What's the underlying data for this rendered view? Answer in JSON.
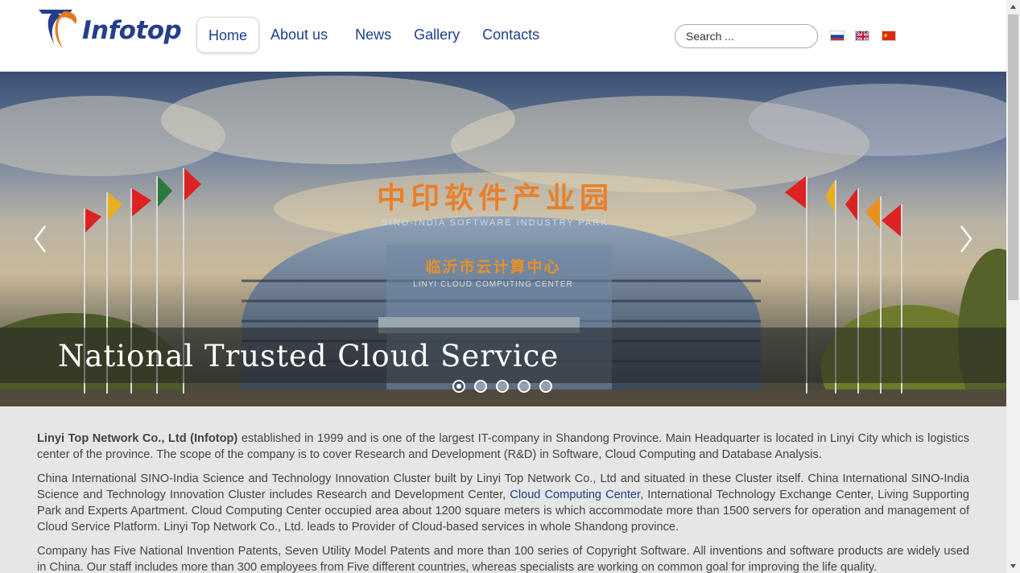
{
  "header": {
    "logo_text": "Infotop",
    "nav": [
      {
        "label": "Home",
        "active": true
      },
      {
        "label": "About us",
        "active": false
      },
      {
        "label": "News",
        "active": false
      },
      {
        "label": "Gallery",
        "active": false
      },
      {
        "label": "Contacts",
        "active": false
      }
    ],
    "search": {
      "placeholder": "Search ..."
    },
    "languages": [
      "russian-flag-icon",
      "english-flag-icon",
      "chinese-flag-icon"
    ]
  },
  "slider": {
    "caption": "National Trusted Cloud Service",
    "building_sign_cn": "中印软件产业园",
    "building_sign_en": "SINO-INDIA SOFTWARE INDUSTRY PARK",
    "center_sign_cn": "临沂市云计算中心",
    "center_sign_en": "LINYI CLOUD COMPUTING CENTER",
    "slides_count": 5,
    "active_slide": 1
  },
  "content": {
    "p1_company": "Linyi Top Network Co., Ltd (Infotop)",
    "p1_text": " established in 1999 and is one of the largest IT-company in Shandong Province. Main Headquarter is located in Linyi City which is logistics center of the province. The scope of the company is to cover Research and Development (R&D) in Software, Cloud Computing and Database Analysis.",
    "p2_before": "China International SINO-India Science and Technology Innovation Cluster built by Linyi Top Network Co., Ltd and situated in these Cluster itself. China International SINO-India Science and Technology Innovation Cluster includes Research and Development Center, ",
    "p2_link": "Cloud Computing Center",
    "p2_after": ", International Technology Exchange Center, Living Supporting Park and Experts Apartment. Cloud Computing Center occupied area about 1200 square meters is which accommodate more than 1500 servers for operation and management of Cloud Service Platform. Linyi Top Network Co., Ltd. leads to Provider of Cloud-based services in whole Shandong  province.",
    "p3_text": "Company has Five National Invention Patents, Seven Utility Model Patents and more than 100 series of Copyright Software. All inventions and software products are widely used in China. Our staff includes more than 300 employees from Five different countries, whereas specialists are working on common goal for improving the life quality."
  },
  "colors": {
    "brand_blue": "#243f8a",
    "brand_orange": "#e87a1e",
    "nav_text": "#1d3f8a",
    "body_text": "#444444"
  }
}
